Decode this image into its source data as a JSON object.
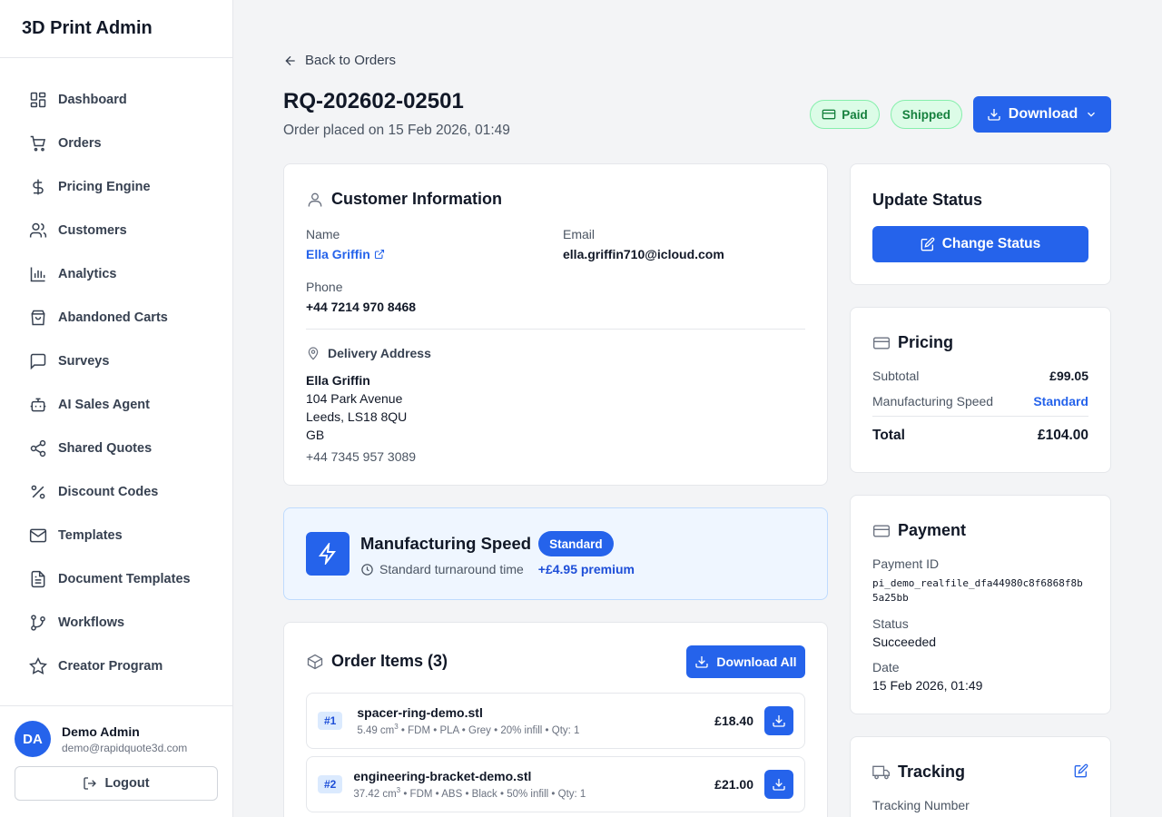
{
  "app": {
    "title": "3D Print Admin"
  },
  "sidebar": {
    "items": [
      {
        "label": "Dashboard"
      },
      {
        "label": "Orders"
      },
      {
        "label": "Pricing Engine"
      },
      {
        "label": "Customers"
      },
      {
        "label": "Analytics"
      },
      {
        "label": "Abandoned Carts"
      },
      {
        "label": "Surveys"
      },
      {
        "label": "AI Sales Agent"
      },
      {
        "label": "Shared Quotes"
      },
      {
        "label": "Discount Codes"
      },
      {
        "label": "Templates"
      },
      {
        "label": "Document Templates"
      },
      {
        "label": "Workflows"
      },
      {
        "label": "Creator Program"
      }
    ],
    "user": {
      "initials": "DA",
      "name": "Demo Admin",
      "email": "demo@rapidquote3d.com"
    },
    "logout_label": "Logout"
  },
  "header": {
    "back_label": "Back to Orders",
    "order_id": "RQ-202602-02501",
    "placed": "Order placed on 15 Feb 2026, 01:49",
    "badges": {
      "paid": "Paid",
      "shipped": "Shipped"
    },
    "download_label": "Download"
  },
  "customer": {
    "title": "Customer Information",
    "name_label": "Name",
    "name": "Ella Griffin",
    "email_label": "Email",
    "email": "ella.griffin710@icloud.com",
    "phone_label": "Phone",
    "phone": "+44 7214 970 8468",
    "delivery_title": "Delivery Address",
    "address": {
      "name": "Ella Griffin",
      "line1": "104 Park Avenue",
      "line2": "Leeds, LS18 8QU",
      "country": "GB",
      "phone": "+44 7345 957 3089"
    }
  },
  "speed": {
    "title": "Manufacturing Speed",
    "badge": "Standard",
    "turnaround": "Standard turnaround time",
    "premium": "+£4.95 premium"
  },
  "items": {
    "title": "Order Items (3)",
    "download_all": "Download All",
    "list": [
      {
        "num": "#1",
        "name": "spacer-ring-demo.stl",
        "volume": "5.49 cm",
        "specs": " • FDM • PLA • Grey • 20% infill • Qty: 1",
        "price": "£18.40"
      },
      {
        "num": "#2",
        "name": "engineering-bracket-demo.stl",
        "volume": "37.42 cm",
        "specs": " • FDM • ABS • Black • 50% infill • Qty: 1",
        "price": "£21.00"
      }
    ],
    "unit_sup": "3"
  },
  "status": {
    "title": "Update Status",
    "button": "Change Status"
  },
  "pricing": {
    "title": "Pricing",
    "subtotal_label": "Subtotal",
    "subtotal": "£99.05",
    "speed_label": "Manufacturing Speed",
    "speed": "Standard",
    "total_label": "Total",
    "total": "£104.00"
  },
  "payment": {
    "title": "Payment",
    "id_label": "Payment ID",
    "id": "pi_demo_realfile_dfa44980c8f6868f8b5a25bb",
    "status_label": "Status",
    "status": "Succeeded",
    "date_label": "Date",
    "date": "15 Feb 2026, 01:49"
  },
  "tracking": {
    "title": "Tracking",
    "number_label": "Tracking Number"
  },
  "colors": {
    "accent": "#2563eb",
    "success_bg": "#dcfce7",
    "success_text": "#15803d"
  }
}
